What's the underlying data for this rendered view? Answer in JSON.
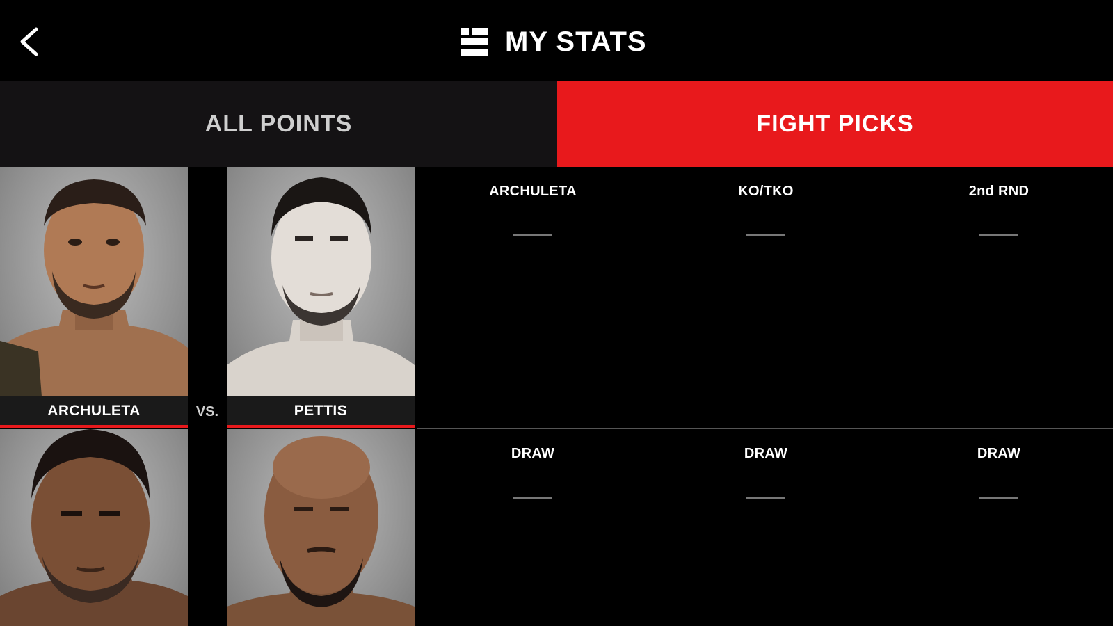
{
  "header": {
    "title": "MY STATS",
    "back_icon": "chevron-left-icon",
    "title_icon": "stats-list-icon"
  },
  "tabs": [
    {
      "label": "ALL POINTS",
      "active": false
    },
    {
      "label": "FIGHT PICKS",
      "active": true
    }
  ],
  "colors": {
    "accent": "#e8191c",
    "tab_inactive_bg": "#141214",
    "background": "#000000"
  },
  "fights": [
    {
      "fighter_left": "ARCHULETA",
      "fighter_right": "PETTIS",
      "vs_label": "VS.",
      "picks": [
        {
          "label": "ARCHULETA",
          "value": "—"
        },
        {
          "label": "KO/TKO",
          "value": "—"
        },
        {
          "label": "2nd RND",
          "value": "—"
        }
      ]
    },
    {
      "picks": [
        {
          "label": "DRAW",
          "value": "—"
        },
        {
          "label": "DRAW",
          "value": "—"
        },
        {
          "label": "DRAW",
          "value": "—"
        }
      ]
    }
  ]
}
